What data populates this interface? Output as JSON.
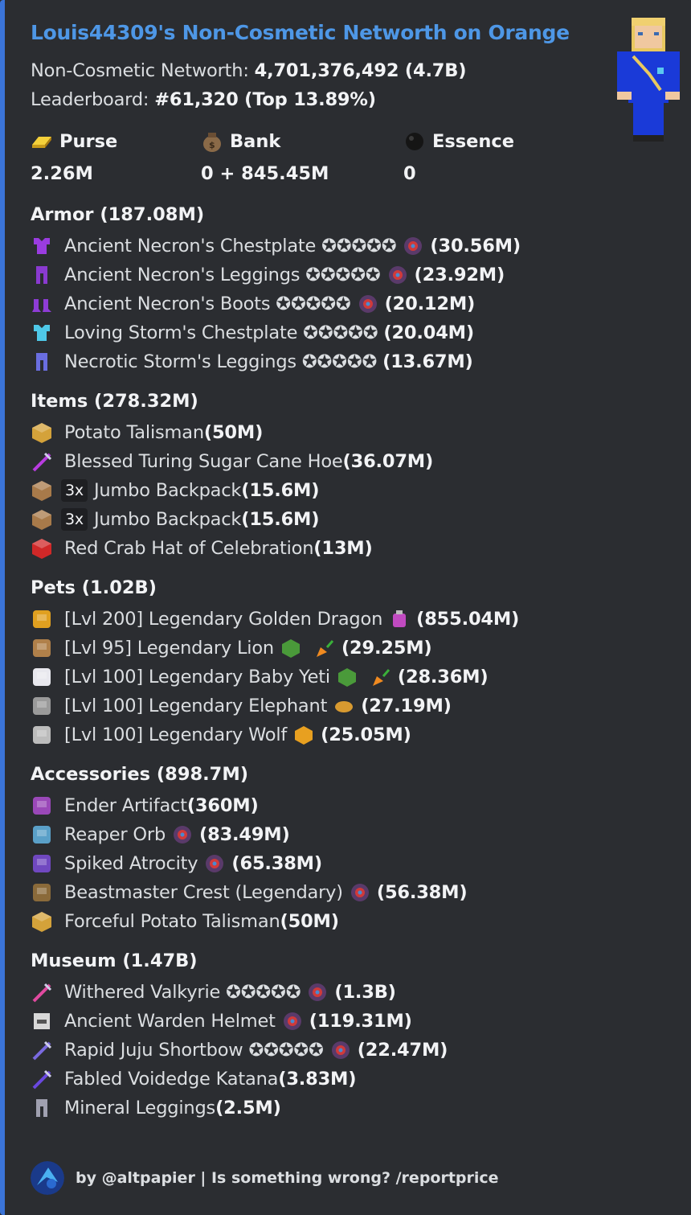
{
  "embed": {
    "title": "Louis44309's Non-Cosmetic Networth on Orange",
    "accent_color": "#3b74d8",
    "title_color": "#4e97e6",
    "networth_label": "Non-Cosmetic Networth: ",
    "networth_value": "4,701,376,492 (4.7B)",
    "leaderboard_label": "Leaderboard: ",
    "leaderboard_value": "#61,320 (Top 13.89%)"
  },
  "stats": [
    {
      "name": "Purse",
      "value": "2.26M",
      "icon": "gold-ingot-icon"
    },
    {
      "name": "Bank",
      "value": "0 + 845.45M",
      "icon": "money-bag-icon"
    },
    {
      "name": "Essence",
      "value": "0",
      "icon": "black-orb-icon"
    }
  ],
  "sections": [
    {
      "title": "Armor (187.08M)",
      "items": [
        {
          "name": "Ancient Necron's Chestplate ✪✪✪✪✪",
          "extra": "recomb",
          "price": "(30.56M)",
          "icon": "chestplate-icon",
          "color": "#9a3ce0"
        },
        {
          "name": "Ancient Necron's Leggings ✪✪✪✪✪",
          "extra": "recomb",
          "price": "(23.92M)",
          "icon": "leggings-icon",
          "color": "#8a3ad0"
        },
        {
          "name": "Ancient Necron's Boots ✪✪✪✪✪",
          "extra": "recomb",
          "price": "(20.12M)",
          "icon": "boots-icon",
          "color": "#8e3cd6"
        },
        {
          "name": "Loving Storm's Chestplate ✪✪✪✪✪",
          "extra": "",
          "price": "(20.04M)",
          "icon": "chestplate-icon",
          "color": "#4ec8e8"
        },
        {
          "name": "Necrotic Storm's Leggings ✪✪✪✪✪",
          "extra": "",
          "price": "(13.67M)",
          "icon": "leggings-icon",
          "color": "#6a6ee0"
        }
      ]
    },
    {
      "title": "Items (278.32M)",
      "items": [
        {
          "name": "Potato Talisman ",
          "price": "(50M)",
          "icon": "potato-talisman-icon",
          "color": "#d4a23a"
        },
        {
          "name": "Blessed Turing Sugar Cane Hoe ",
          "price": "(36.07M)",
          "icon": "hoe-icon",
          "color": "#b83ce0"
        },
        {
          "qty": "3x",
          "name": "Jumbo Backpack ",
          "price": "(15.6M)",
          "icon": "backpack-icon",
          "color": "#a87a4a"
        },
        {
          "qty": "3x",
          "name": "Jumbo Backpack ",
          "price": "(15.6M)",
          "icon": "backpack-icon",
          "color": "#a87a4a"
        },
        {
          "name": "Red Crab Hat of Celebration ",
          "price": "(13M)",
          "icon": "crab-hat-icon",
          "color": "#d02828"
        }
      ]
    },
    {
      "title": "Pets (1.02B)",
      "items": [
        {
          "name": "[Lvl 200] Legendary Golden Dragon",
          "extras": [
            "potion"
          ],
          "price": "(855.04M)",
          "icon": "golden-dragon-icon",
          "color": "#e0a020"
        },
        {
          "name": "[Lvl 95] Legendary Lion",
          "extras": [
            "green-cube",
            "carrot"
          ],
          "price": "(29.25M)",
          "icon": "lion-icon",
          "color": "#b0804a"
        },
        {
          "name": "[Lvl 100] Legendary Baby Yeti",
          "extras": [
            "green-cube",
            "carrot"
          ],
          "price": "(28.36M)",
          "icon": "yeti-icon",
          "color": "#e8e8ee"
        },
        {
          "name": "[Lvl 100] Legendary Elephant",
          "extras": [
            "bread"
          ],
          "price": "(27.19M)",
          "icon": "elephant-icon",
          "color": "#9a9a9a"
        },
        {
          "name": "[Lvl 100] Legendary Wolf",
          "extras": [
            "orange-cube"
          ],
          "price": "(25.05M)",
          "icon": "wolf-icon",
          "color": "#bcbcbc"
        }
      ]
    },
    {
      "title": "Accessories (898.7M)",
      "items": [
        {
          "name": "Ender Artifact ",
          "price": "(360M)",
          "icon": "ender-artifact-icon",
          "color": "#9a48b8"
        },
        {
          "name": "Reaper Orb",
          "extras": [
            "recomb"
          ],
          "price": "(83.49M)",
          "icon": "reaper-orb-icon",
          "color": "#5aa0c8"
        },
        {
          "name": "Spiked Atrocity",
          "extras": [
            "recomb"
          ],
          "price": "(65.38M)",
          "icon": "spiked-atrocity-icon",
          "color": "#7048c0"
        },
        {
          "name": "Beastmaster Crest (Legendary)",
          "extras": [
            "recomb"
          ],
          "price": "(56.38M)",
          "icon": "beastmaster-crest-icon",
          "color": "#8a6a3a"
        },
        {
          "name": "Forceful Potato Talisman ",
          "price": "(50M)",
          "icon": "potato-talisman-icon",
          "color": "#d4a23a"
        }
      ]
    },
    {
      "title": "Museum (1.47B)",
      "items": [
        {
          "name": "Withered Valkyrie ✪✪✪✪✪",
          "extras": [
            "recomb"
          ],
          "price": "(1.3B)",
          "icon": "sword-icon",
          "color": "#e04aa0"
        },
        {
          "name": "Ancient Warden Helmet",
          "extras": [
            "recomb"
          ],
          "price": "(119.31M)",
          "icon": "helmet-icon",
          "color": "#d8d8d8"
        },
        {
          "name": "Rapid Juju Shortbow ✪✪✪✪✪",
          "extras": [
            "recomb"
          ],
          "price": "(22.47M)",
          "icon": "bow-icon",
          "color": "#7a6ae0"
        },
        {
          "name": "Fabled Voidedge Katana ",
          "price": "(3.83M)",
          "icon": "katana-icon",
          "color": "#6a48e0"
        },
        {
          "name": "Mineral Leggings ",
          "price": "(2.5M)",
          "icon": "leggings-icon",
          "color": "#a0a0b0"
        }
      ]
    }
  ],
  "footer": {
    "text": "by @altpapier | Is something wrong? /reportprice"
  }
}
